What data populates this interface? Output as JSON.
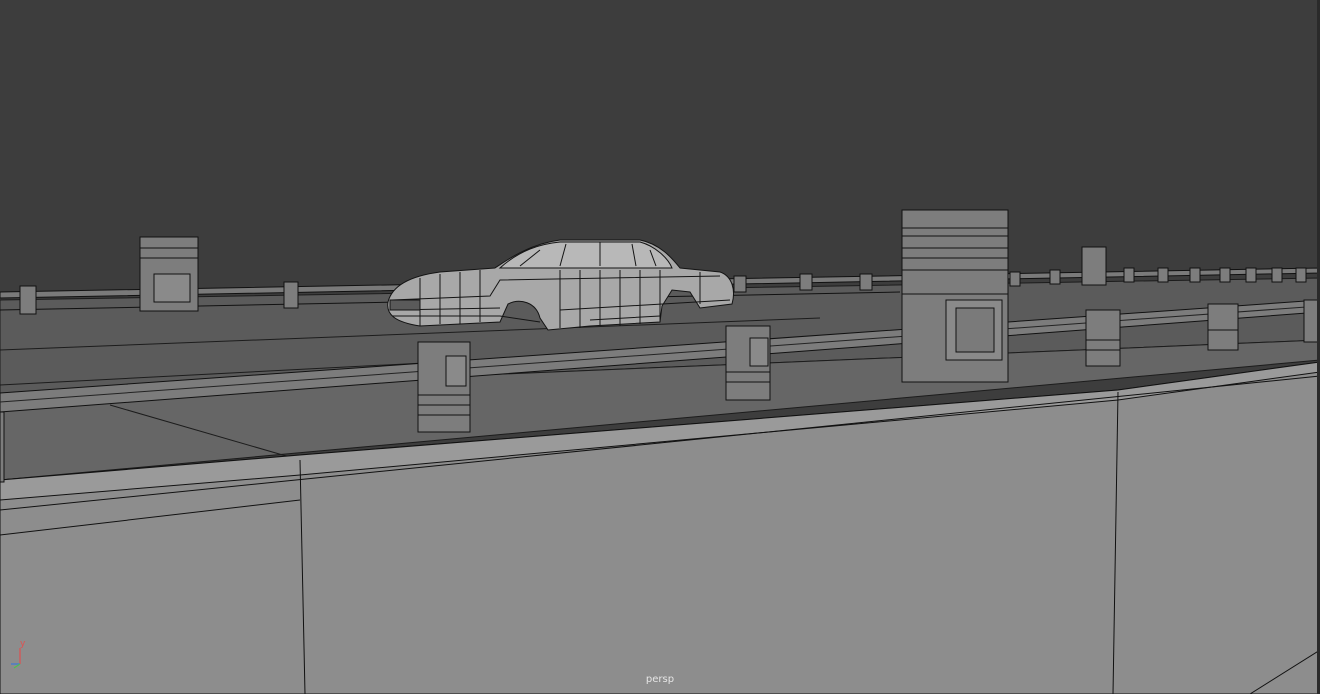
{
  "viewport": {
    "camera": "persp",
    "colors": {
      "background": "#3d3d3d",
      "ground": "#5e5e5e",
      "wall": "#8f8f8f",
      "wireframe": "#1a1a1a",
      "axis_x": "#3c7ad6",
      "axis_y": "#e05050"
    }
  },
  "axis_gizmo": {
    "y_label": "y"
  },
  "scene_objects": [
    "car-mesh",
    "guardrail-near",
    "guardrail-far",
    "concrete-wall",
    "ground-plane",
    "bollards"
  ]
}
